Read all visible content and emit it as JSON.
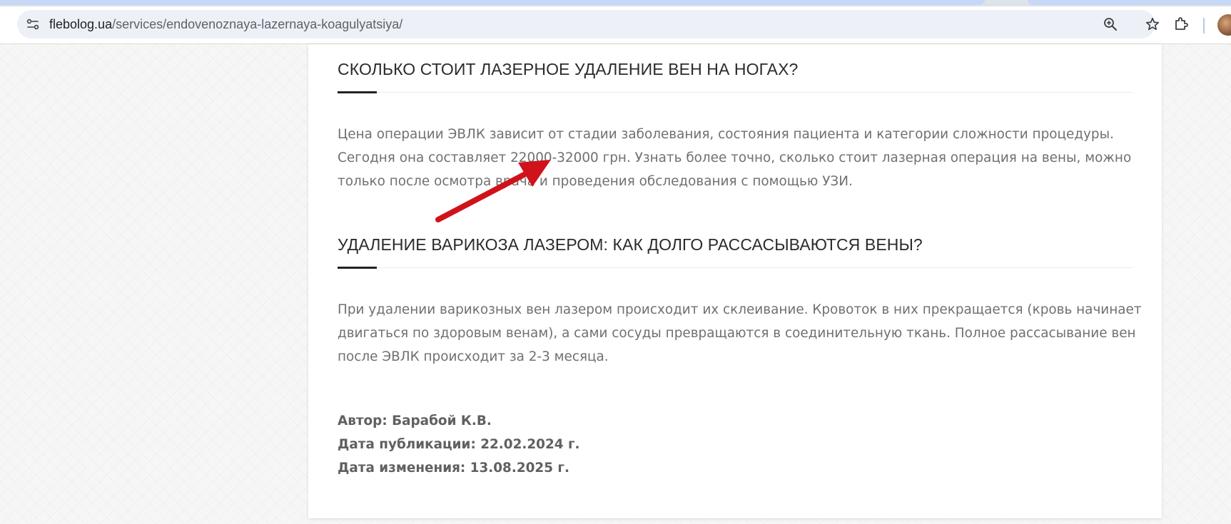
{
  "browser": {
    "url_host": "flebolog.ua",
    "url_path": "/services/endovenoznaya-lazernaya-koagulyatsiya/",
    "icons": [
      "site-info-icon",
      "zoom-icon",
      "bookmark-star-icon",
      "extensions-icon",
      "profile-avatar"
    ]
  },
  "article": {
    "sections": [
      {
        "title": "СКОЛЬКО СТОИТ ЛАЗЕРНОЕ УДАЛЕНИЕ ВЕН НА НОГАХ?",
        "body": "Цена операции ЭВЛК зависит от стадии заболевания, состояния пациента и категории сложности процедуры. Сегодня она составляет 22000-32000 грн. Узнать более точно, сколько стоит лазерная операция на вены, можно только после осмотра врача и проведения обследования с помощью УЗИ."
      },
      {
        "title": "УДАЛЕНИЕ ВАРИКОЗА ЛАЗЕРОМ: КАК ДОЛГО РАССАСЫВАЮТСЯ ВЕНЫ?",
        "body": "При удалении варикозных вен лазером происходит их склеивание. Кровоток в них прекращается (кровь начинает двигаться по здоровым венам), а сами сосуды превращаются в соединительную ткань. Полное рассасывание вен после ЭВЛК происходит за 2-3 месяца."
      }
    ],
    "author": "Автор: Барабой К.В.",
    "published": "Дата публикации: 22.02.2024 г.",
    "modified": "Дата изменения: 13.08.2025 г."
  },
  "colors": {
    "annotation_arrow": "#d0121b",
    "accent_rule": "#222222",
    "body_text": "#707070"
  }
}
